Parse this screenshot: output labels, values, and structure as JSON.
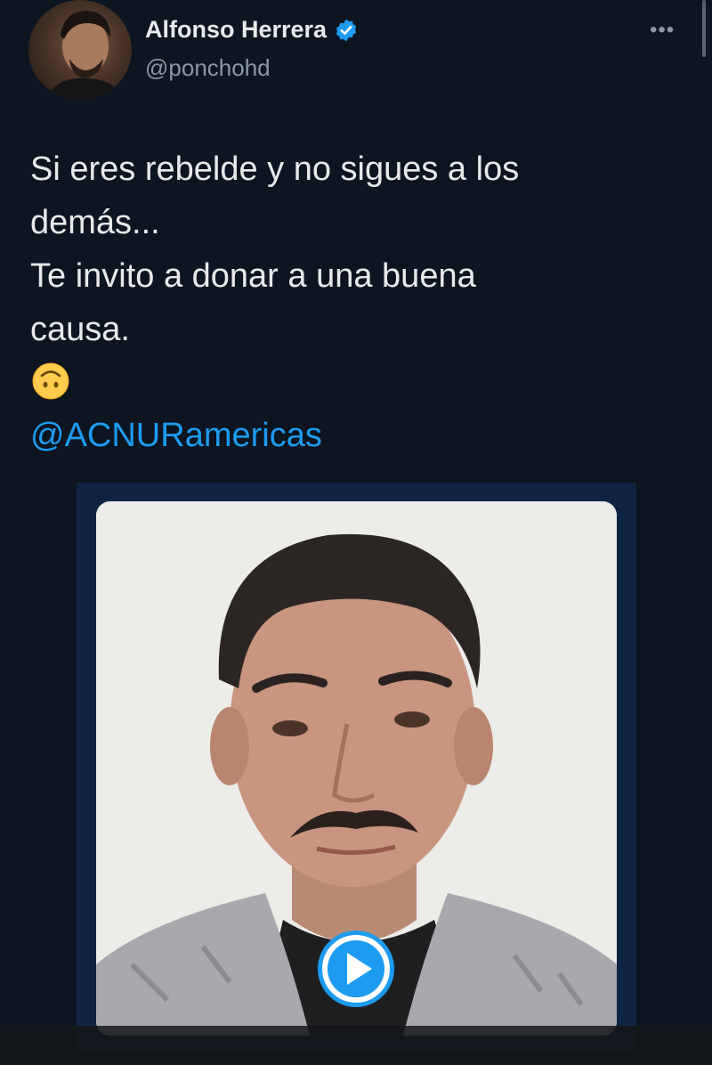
{
  "author": {
    "display_name": "Alfonso Herrera",
    "handle": "@ponchohd",
    "verified_icon": "verified-badge-icon",
    "avatar_icon": "avatar-photo"
  },
  "menu": {
    "more_icon": "more-dots-icon",
    "more_label": "•••"
  },
  "tweet": {
    "lines": [
      "Si eres rebelde y no sigues a los",
      "demás...",
      "Te invito a donar a una buena",
      "causa."
    ],
    "emoji_icon": "upside-down-face-emoji-icon",
    "mention": "@ACNURamericas"
  },
  "media": {
    "type": "video",
    "play_icon": "play-icon"
  },
  "colors": {
    "background": "#0d1521",
    "text": "#e7e9ea",
    "secondary": "#8b98a5",
    "link": "#1d9bf0",
    "media_frame": "#0f2440"
  }
}
